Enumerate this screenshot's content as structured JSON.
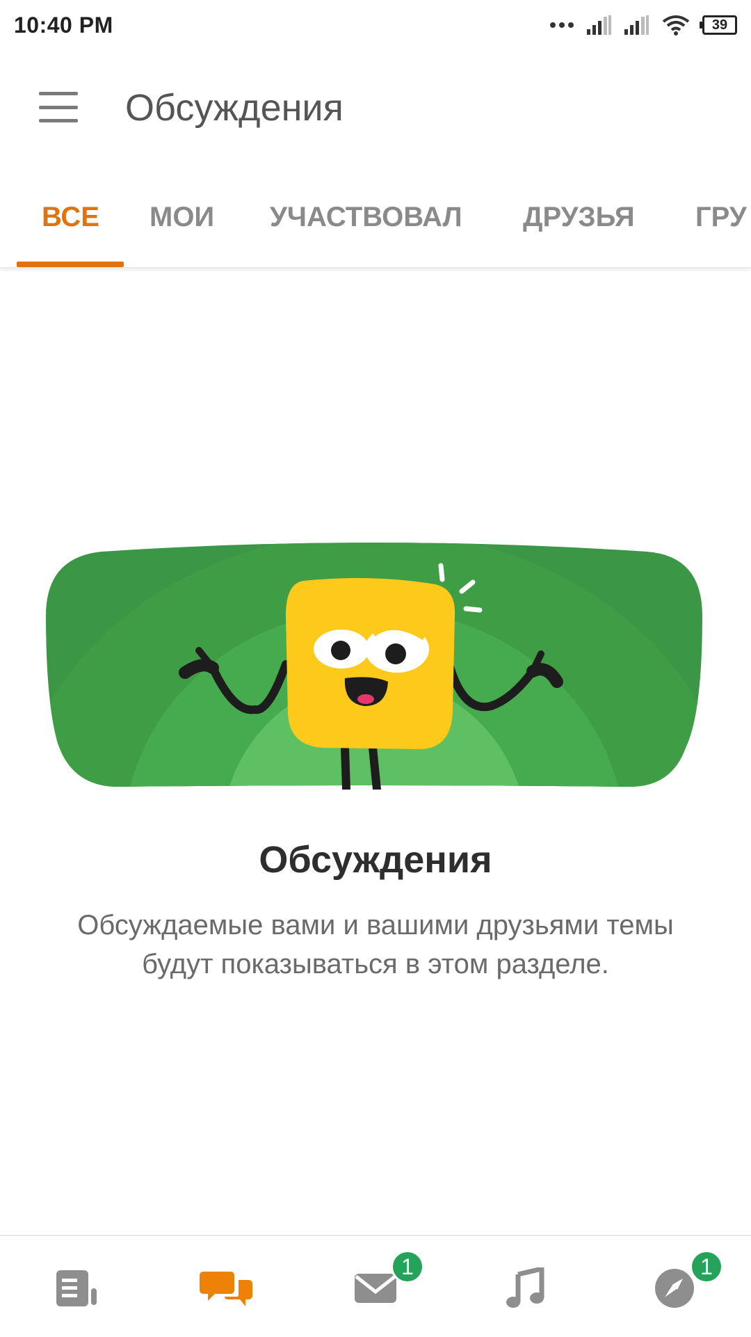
{
  "status_bar": {
    "time": "10:40 PM",
    "battery": "39"
  },
  "toolbar": {
    "title": "Обсуждения"
  },
  "tabs": [
    {
      "label": "ВСЕ",
      "active": true
    },
    {
      "label": "МОИ",
      "active": false
    },
    {
      "label": "УЧАСТВОВАЛ",
      "active": false
    },
    {
      "label": "ДРУЗЬЯ",
      "active": false
    },
    {
      "label": "ГРУ",
      "active": false
    }
  ],
  "empty_state": {
    "title": "Обсуждения",
    "text": "Обсуждаемые вами и вашими друзьями темы будут показываться в этом разделе."
  },
  "bottom_nav": {
    "items": [
      {
        "icon": "feed-icon",
        "badge": null
      },
      {
        "icon": "discussions-icon",
        "badge": null,
        "active": true
      },
      {
        "icon": "messages-icon",
        "badge": "1"
      },
      {
        "icon": "music-icon",
        "badge": null
      },
      {
        "icon": "notifications-icon",
        "badge": "1"
      }
    ]
  },
  "colors": {
    "accent": "#e2720c",
    "badge": "#25a35a",
    "illustration_green": "#3f9d45",
    "character_yellow": "#fdca1b"
  }
}
